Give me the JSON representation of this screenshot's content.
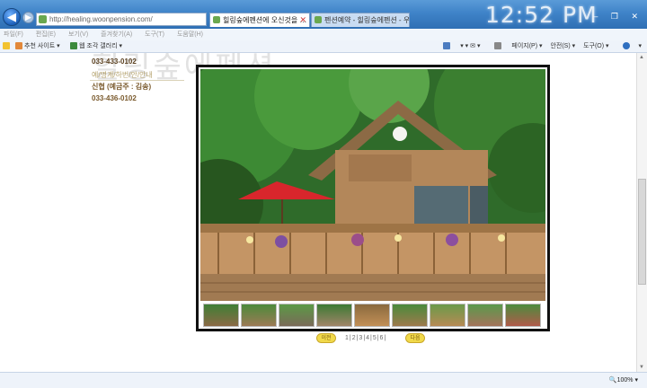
{
  "browser": {
    "address": "http://healing.woonpension.com/",
    "address_tools": "▾ ↻ ✕",
    "tabs": [
      {
        "label": "힐링숲에펜션에 오신것을 …",
        "close": "✕"
      },
      {
        "label": "펜션예약 - 힐링숲에펜션 - 우…"
      }
    ],
    "clock": "12:52 PM",
    "window_controls": "– ❐ ✕",
    "menu": [
      "파일(F)",
      "편집(E)",
      "보기(V)",
      "즐겨찾기(A)",
      "도구(T)",
      "도움말(H)"
    ],
    "favorites_bar": {
      "suggested_sites": "추천 사이트 ▾",
      "web_slice_gallery": "웹 조각 갤러리 ▾"
    },
    "command_bar": {
      "icons": "▾ ▾ ✉ ▾",
      "page": "페이지(P) ▾",
      "safety": "안전(S) ▾",
      "tools": "도구(O) ▾",
      "help": "▾"
    },
    "zoom": "100%"
  },
  "page": {
    "watermark": "힐링숲에펜션",
    "contact": {
      "phone_1": "033-433-0102",
      "links": "예/명계/하번/안/안내",
      "bank": "신협 (예금주 : 김송)",
      "phone_2": "033-436-0102"
    },
    "gallery": {
      "thumbnail_count": 9,
      "pager": {
        "prev": "이전",
        "pages": "1|2|3|4|5|6|",
        "next": "다음"
      }
    }
  },
  "colors": {
    "title_bar": "#3f83c8",
    "contact_text": "#7a5a2d",
    "pager_button": "#f1d94a",
    "photo_frame": "#111111"
  },
  "icons": [
    "back-arrow-icon",
    "forward-arrow-icon",
    "favorites-star-icon",
    "home-icon",
    "print-icon",
    "help-icon",
    "zoom-icon"
  ]
}
